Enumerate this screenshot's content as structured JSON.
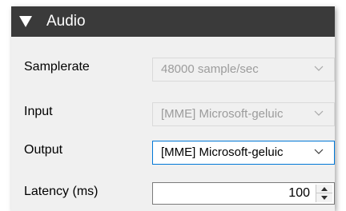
{
  "section": {
    "title": "Audio",
    "expand_icon": "triangle-down-icon"
  },
  "fields": {
    "samplerate": {
      "label": "Samplerate",
      "value": "48000 sample/sec"
    },
    "input": {
      "label": "Input",
      "value": "[MME] Microsoft-geluic"
    },
    "output": {
      "label": "Output",
      "value": "[MME] Microsoft-geluic"
    },
    "latency": {
      "label": "Latency (ms)",
      "value": "100"
    }
  },
  "colors": {
    "header_bg": "#3a3a3a",
    "panel_bg": "#f0f0f0",
    "focus_border": "#0078d7",
    "disabled_text": "#9c9c9c"
  }
}
